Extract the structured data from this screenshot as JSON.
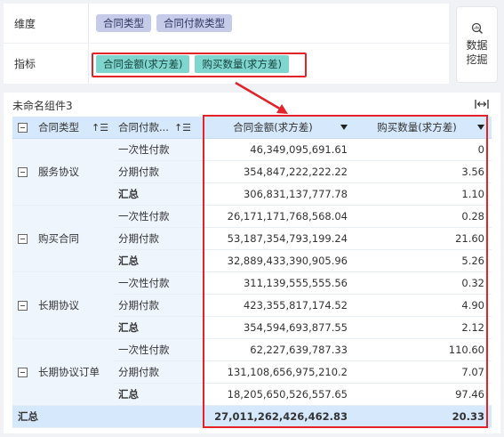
{
  "config": {
    "dimension_label": "维度",
    "dimensions": [
      "合同类型",
      "合同付款类型"
    ],
    "indicator_label": "指标",
    "indicators": [
      "合同金额(求方差)",
      "购买数量(求方差)"
    ]
  },
  "mining_button": "数据挖掘",
  "widget": {
    "title": "未命名组件3",
    "headers": [
      "合同类型",
      "合同付款...",
      "合同金额(求方差)",
      "购买数量(求方差)"
    ],
    "groups": [
      {
        "name": "服务协议",
        "rows": [
          {
            "type": "一次性付款",
            "amount": "46,349,095,691.61",
            "qty": "0"
          },
          {
            "type": "分期付款",
            "amount": "354,847,222,222.22",
            "qty": "3.56"
          },
          {
            "type": "汇总",
            "amount": "306,831,137,777.78",
            "qty": "1.10"
          }
        ]
      },
      {
        "name": "购买合同",
        "rows": [
          {
            "type": "一次性付款",
            "amount": "26,171,171,768,568.04",
            "qty": "0.28"
          },
          {
            "type": "分期付款",
            "amount": "53,187,354,793,199.24",
            "qty": "21.60"
          },
          {
            "type": "汇总",
            "amount": "32,889,433,390,905.96",
            "qty": "5.26"
          }
        ]
      },
      {
        "name": "长期协议",
        "rows": [
          {
            "type": "一次性付款",
            "amount": "311,139,555,555.56",
            "qty": "0.32"
          },
          {
            "type": "分期付款",
            "amount": "423,355,817,174.52",
            "qty": "4.90"
          },
          {
            "type": "汇总",
            "amount": "354,594,693,877.55",
            "qty": "2.12"
          }
        ]
      },
      {
        "name": "长期协议订单",
        "rows": [
          {
            "type": "一次性付款",
            "amount": "62,227,639,787.33",
            "qty": "110.60"
          },
          {
            "type": "分期付款",
            "amount": "131,108,656,975,210.2",
            "qty": "7.07"
          },
          {
            "type": "汇总",
            "amount": "18,205,650,526,557.65",
            "qty": "97.46"
          }
        ]
      }
    ],
    "total": {
      "label": "汇总",
      "amount": "27,011,262,426,462.83",
      "qty": "20.33"
    }
  },
  "colors": {
    "highlight": "#e2232a",
    "header_bg": "#d6e8fb",
    "dim_chip": "#c5cbe9",
    "ind_chip": "#7fd6cf"
  }
}
